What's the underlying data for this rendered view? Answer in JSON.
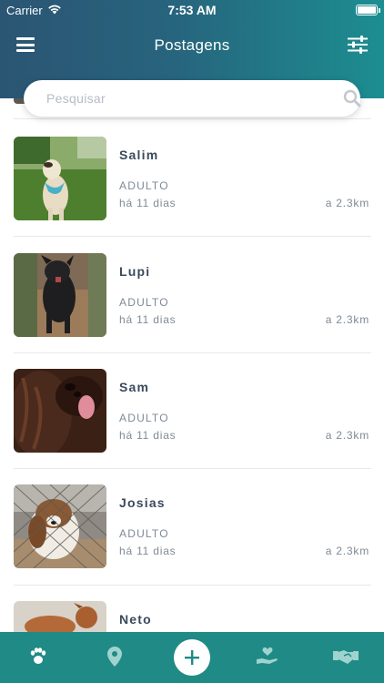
{
  "status_bar": {
    "carrier": "Carrier",
    "time": "7:53 AM"
  },
  "header": {
    "title": "Postagens"
  },
  "search": {
    "placeholder": "Pesquisar"
  },
  "pets": [
    {
      "name": "Salim",
      "age": "ADULTO",
      "posted": "há 11 dias",
      "distance": "a 2.3km"
    },
    {
      "name": "Lupi",
      "age": "ADULTO",
      "posted": "há 11 dias",
      "distance": "a 2.3km"
    },
    {
      "name": "Sam",
      "age": "ADULTO",
      "posted": "há 11 dias",
      "distance": "a 2.3km"
    },
    {
      "name": "Josias",
      "age": "ADULTO",
      "posted": "há 11 dias",
      "distance": "a 2.3km"
    },
    {
      "name": "Neto",
      "age": "",
      "posted": "",
      "distance": ""
    }
  ],
  "tabbar": {
    "items": [
      "paw-icon",
      "location-pin-icon",
      "add-icon",
      "hand-heart-icon",
      "handshake-icon"
    ],
    "color": "#1f8a86"
  },
  "colors": {
    "header_start": "#2b5573",
    "header_end": "#1c8e91",
    "text_name": "#3a4a5c",
    "text_meta": "#7f8a96"
  }
}
